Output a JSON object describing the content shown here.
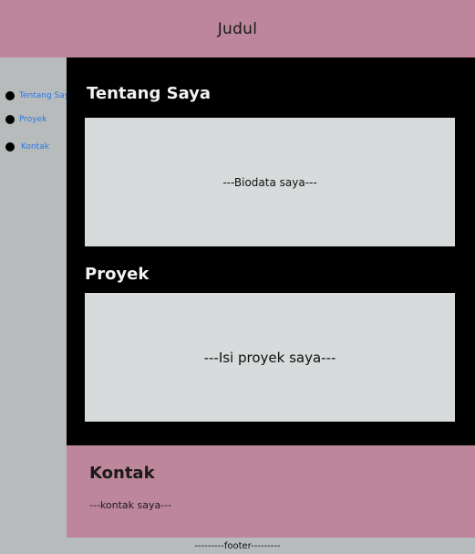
{
  "header": {
    "title": "Judul"
  },
  "sidebar": {
    "items": [
      {
        "label": "Tentang Saya"
      },
      {
        "label": "Proyek"
      },
      {
        "label": "Kontak"
      }
    ]
  },
  "main": {
    "about": {
      "title": "Tentang Saya",
      "content": "---Biodata saya---"
    },
    "projects": {
      "title": "Proyek",
      "content": "---Isi proyek saya---"
    }
  },
  "contact": {
    "title": "Kontak",
    "content": "---kontak saya---"
  },
  "footer": {
    "text": "---------footer---------"
  },
  "colors": {
    "header_bg": "#bd869b",
    "sidebar_bg": "#b7bbbc",
    "main_bg": "#000000",
    "panel_bg": "#d7dbdb",
    "link": "#2a77e6"
  }
}
